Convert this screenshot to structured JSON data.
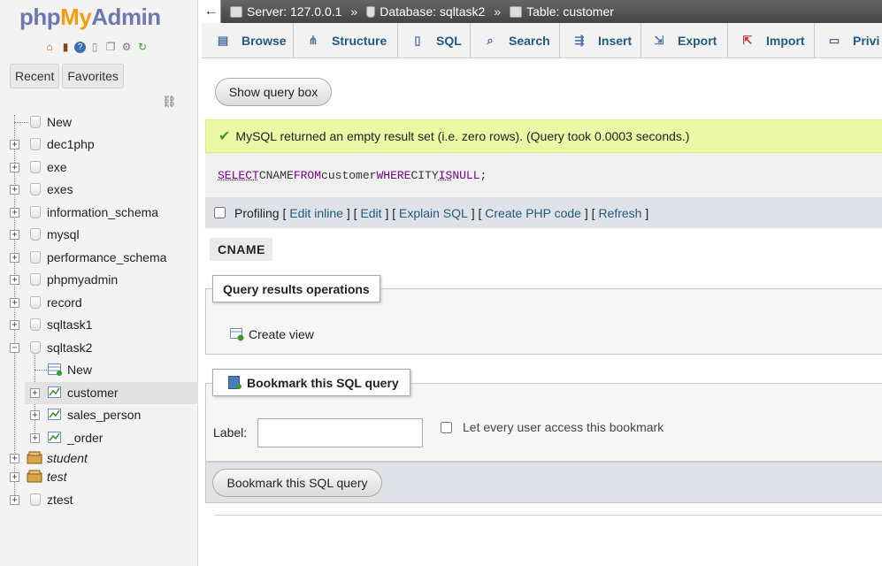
{
  "logo": {
    "part1": "php",
    "part2": "My",
    "part3": "Admin"
  },
  "quick_icons": [
    "home-icon",
    "logout-icon",
    "help-icon",
    "docs-icon",
    "copy-icon",
    "settings-icon",
    "reload-icon"
  ],
  "left_tabs": {
    "recent": "Recent",
    "favorites": "Favorites"
  },
  "tree": {
    "new_db": "New",
    "databases": [
      {
        "name": "dec1php"
      },
      {
        "name": "exe"
      },
      {
        "name": "exes"
      },
      {
        "name": "information_schema"
      },
      {
        "name": "mysql"
      },
      {
        "name": "performance_schema"
      },
      {
        "name": "phpmyadmin"
      },
      {
        "name": "record"
      },
      {
        "name": "sqltask1"
      },
      {
        "name": "sqltask2"
      }
    ],
    "sqltask2_children": {
      "new": "New",
      "tables": [
        "customer",
        "sales_person",
        "_order"
      ]
    },
    "more": [
      {
        "name": "student"
      },
      {
        "name": "test"
      },
      {
        "name": "ztest"
      }
    ]
  },
  "breadcrumb": {
    "server": "Server: 127.0.0.1",
    "database": "Database: sqltask2",
    "table": "Table: customer",
    "sep": "»"
  },
  "tabs": [
    {
      "label": "Browse",
      "icon": "browse-icon"
    },
    {
      "label": "Structure",
      "icon": "structure-icon"
    },
    {
      "label": "SQL",
      "icon": "sql-icon"
    },
    {
      "label": "Search",
      "icon": "search-icon"
    },
    {
      "label": "Insert",
      "icon": "insert-icon"
    },
    {
      "label": "Export",
      "icon": "export-icon"
    },
    {
      "label": "Import",
      "icon": "import-icon"
    },
    {
      "label": "Privi",
      "icon": "privileges-icon"
    }
  ],
  "show_query_box": "Show query box",
  "success_message": "MySQL returned an empty result set (i.e. zero rows). (Query took 0.0003 seconds.)",
  "sql": {
    "select": "SELECT",
    "cols": " CNAME ",
    "from": "FROM",
    "table": " customer ",
    "where": "WHERE",
    "col": " CITY ",
    "is": "IS",
    "null": " NULL",
    "end": ";"
  },
  "profiling": {
    "label": "Profiling",
    "lb": "[",
    "rb": "]",
    "links": [
      "Edit inline",
      "Edit",
      "Explain SQL",
      "Create PHP code",
      "Refresh"
    ]
  },
  "result_column": "CNAME",
  "query_ops": {
    "legend": "Query results operations",
    "create_view": "Create view"
  },
  "bookmark": {
    "legend": "Bookmark this SQL query",
    "label": "Label:",
    "label_value": "",
    "every_user": "Let every user access this bookmark",
    "submit": "Bookmark this SQL query"
  }
}
